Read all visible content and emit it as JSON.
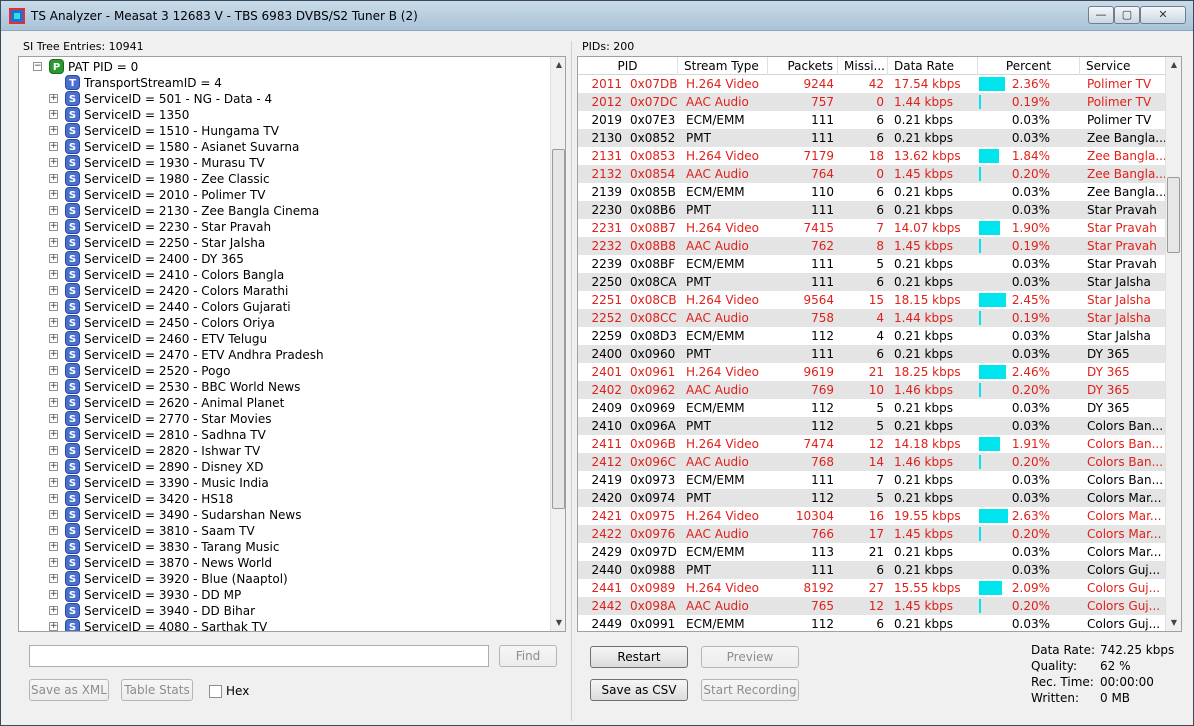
{
  "window": {
    "title": "TS Analyzer - Measat 3 12683 V - TBS 6983 DVBS/S2 Tuner B (2)",
    "min": "—",
    "max": "▢",
    "close": "✕"
  },
  "left": {
    "label": "SI Tree Entries: 10941",
    "tree": [
      {
        "type": "p",
        "text": "PAT PID = 0",
        "expander": "−"
      },
      {
        "type": "t",
        "text": "TransportStreamID = 4"
      },
      {
        "type": "s",
        "text": "ServiceID = 501 - NG - Data - 4"
      },
      {
        "type": "s",
        "text": "ServiceID = 1350"
      },
      {
        "type": "s",
        "text": "ServiceID = 1510 - Hungama TV"
      },
      {
        "type": "s",
        "text": "ServiceID = 1580 - Asianet Suvarna"
      },
      {
        "type": "s",
        "text": "ServiceID = 1930 - Murasu TV"
      },
      {
        "type": "s",
        "text": "ServiceID = 1980 - Zee Classic"
      },
      {
        "type": "s",
        "text": "ServiceID = 2010 - Polimer TV"
      },
      {
        "type": "s",
        "text": "ServiceID = 2130 - Zee Bangla Cinema"
      },
      {
        "type": "s",
        "text": "ServiceID = 2230 - Star Pravah"
      },
      {
        "type": "s",
        "text": "ServiceID = 2250 - Star Jalsha"
      },
      {
        "type": "s",
        "text": "ServiceID = 2400 - DY 365"
      },
      {
        "type": "s",
        "text": "ServiceID = 2410 - Colors Bangla"
      },
      {
        "type": "s",
        "text": "ServiceID = 2420 - Colors Marathi"
      },
      {
        "type": "s",
        "text": "ServiceID = 2440 - Colors Gujarati"
      },
      {
        "type": "s",
        "text": "ServiceID = 2450 - Colors Oriya"
      },
      {
        "type": "s",
        "text": "ServiceID = 2460 - ETV Telugu"
      },
      {
        "type": "s",
        "text": "ServiceID = 2470 - ETV Andhra Pradesh"
      },
      {
        "type": "s",
        "text": "ServiceID = 2520 - Pogo"
      },
      {
        "type": "s",
        "text": "ServiceID = 2530 - BBC World News"
      },
      {
        "type": "s",
        "text": "ServiceID = 2620 - Animal Planet"
      },
      {
        "type": "s",
        "text": "ServiceID = 2770 - Star Movies"
      },
      {
        "type": "s",
        "text": "ServiceID = 2810 - Sadhna TV"
      },
      {
        "type": "s",
        "text": "ServiceID = 2820 - Ishwar TV"
      },
      {
        "type": "s",
        "text": "ServiceID = 2890 - Disney XD"
      },
      {
        "type": "s",
        "text": "ServiceID = 3390 - Music India"
      },
      {
        "type": "s",
        "text": "ServiceID = 3420 - HS18"
      },
      {
        "type": "s",
        "text": "ServiceID = 3490 - Sudarshan News"
      },
      {
        "type": "s",
        "text": "ServiceID = 3810 - Saam TV"
      },
      {
        "type": "s",
        "text": "ServiceID = 3830 - Tarang Music"
      },
      {
        "type": "s",
        "text": "ServiceID = 3870 - News World"
      },
      {
        "type": "s",
        "text": "ServiceID = 3920 - Blue (Naaptol)"
      },
      {
        "type": "s",
        "text": "ServiceID = 3930 - DD MP"
      },
      {
        "type": "s",
        "text": "ServiceID = 3940 - DD Bihar"
      },
      {
        "type": "s",
        "text": "ServiceID = 4080 - Sarthak TV"
      }
    ],
    "search_placeholder": "",
    "find": "Find",
    "save_xml": "Save as XML",
    "table_stats": "Table Stats",
    "hex": "Hex"
  },
  "right": {
    "label": "PIDs: 200",
    "columns": [
      "PID",
      "Stream Type",
      "Packets",
      "Missi...",
      "Data Rate",
      "Percent",
      "Service"
    ],
    "rows": [
      {
        "pid": "2011",
        "hex": "0x07DB",
        "type": "H.264 Video",
        "packets": "9244",
        "miss": "42",
        "rate": "17.54 kbps",
        "pct": "2.36%",
        "pctv": 2.36,
        "service": "Polimer TV",
        "red": true
      },
      {
        "pid": "2012",
        "hex": "0x07DC",
        "type": "AAC Audio",
        "packets": "757",
        "miss": "0",
        "rate": "1.44 kbps",
        "pct": "0.19%",
        "pctv": 0.19,
        "service": "Polimer TV",
        "red": true
      },
      {
        "pid": "2019",
        "hex": "0x07E3",
        "type": "ECM/EMM",
        "packets": "111",
        "miss": "6",
        "rate": "0.21 kbps",
        "pct": "0.03%",
        "pctv": 0,
        "service": "Polimer TV",
        "red": false
      },
      {
        "pid": "2130",
        "hex": "0x0852",
        "type": "PMT",
        "packets": "111",
        "miss": "6",
        "rate": "0.21 kbps",
        "pct": "0.03%",
        "pctv": 0,
        "service": "Zee Bangla...",
        "red": false
      },
      {
        "pid": "2131",
        "hex": "0x0853",
        "type": "H.264 Video",
        "packets": "7179",
        "miss": "18",
        "rate": "13.62 kbps",
        "pct": "1.84%",
        "pctv": 1.84,
        "service": "Zee Bangla...",
        "red": true
      },
      {
        "pid": "2132",
        "hex": "0x0854",
        "type": "AAC Audio",
        "packets": "764",
        "miss": "0",
        "rate": "1.45 kbps",
        "pct": "0.20%",
        "pctv": 0.2,
        "service": "Zee Bangla...",
        "red": true
      },
      {
        "pid": "2139",
        "hex": "0x085B",
        "type": "ECM/EMM",
        "packets": "110",
        "miss": "6",
        "rate": "0.21 kbps",
        "pct": "0.03%",
        "pctv": 0,
        "service": "Zee Bangla...",
        "red": false
      },
      {
        "pid": "2230",
        "hex": "0x08B6",
        "type": "PMT",
        "packets": "111",
        "miss": "6",
        "rate": "0.21 kbps",
        "pct": "0.03%",
        "pctv": 0,
        "service": "Star Pravah",
        "red": false
      },
      {
        "pid": "2231",
        "hex": "0x08B7",
        "type": "H.264 Video",
        "packets": "7415",
        "miss": "7",
        "rate": "14.07 kbps",
        "pct": "1.90%",
        "pctv": 1.9,
        "service": "Star Pravah",
        "red": true
      },
      {
        "pid": "2232",
        "hex": "0x08B8",
        "type": "AAC Audio",
        "packets": "762",
        "miss": "8",
        "rate": "1.45 kbps",
        "pct": "0.19%",
        "pctv": 0.19,
        "service": "Star Pravah",
        "red": true
      },
      {
        "pid": "2239",
        "hex": "0x08BF",
        "type": "ECM/EMM",
        "packets": "111",
        "miss": "5",
        "rate": "0.21 kbps",
        "pct": "0.03%",
        "pctv": 0,
        "service": "Star Pravah",
        "red": false
      },
      {
        "pid": "2250",
        "hex": "0x08CA",
        "type": "PMT",
        "packets": "111",
        "miss": "6",
        "rate": "0.21 kbps",
        "pct": "0.03%",
        "pctv": 0,
        "service": "Star Jalsha",
        "red": false
      },
      {
        "pid": "2251",
        "hex": "0x08CB",
        "type": "H.264 Video",
        "packets": "9564",
        "miss": "15",
        "rate": "18.15 kbps",
        "pct": "2.45%",
        "pctv": 2.45,
        "service": "Star Jalsha",
        "red": true
      },
      {
        "pid": "2252",
        "hex": "0x08CC",
        "type": "AAC Audio",
        "packets": "758",
        "miss": "4",
        "rate": "1.44 kbps",
        "pct": "0.19%",
        "pctv": 0.19,
        "service": "Star Jalsha",
        "red": true
      },
      {
        "pid": "2259",
        "hex": "0x08D3",
        "type": "ECM/EMM",
        "packets": "112",
        "miss": "4",
        "rate": "0.21 kbps",
        "pct": "0.03%",
        "pctv": 0,
        "service": "Star Jalsha",
        "red": false
      },
      {
        "pid": "2400",
        "hex": "0x0960",
        "type": "PMT",
        "packets": "111",
        "miss": "6",
        "rate": "0.21 kbps",
        "pct": "0.03%",
        "pctv": 0,
        "service": "DY 365",
        "red": false
      },
      {
        "pid": "2401",
        "hex": "0x0961",
        "type": "H.264 Video",
        "packets": "9619",
        "miss": "21",
        "rate": "18.25 kbps",
        "pct": "2.46%",
        "pctv": 2.46,
        "service": "DY 365",
        "red": true
      },
      {
        "pid": "2402",
        "hex": "0x0962",
        "type": "AAC Audio",
        "packets": "769",
        "miss": "10",
        "rate": "1.46 kbps",
        "pct": "0.20%",
        "pctv": 0.2,
        "service": "DY 365",
        "red": true
      },
      {
        "pid": "2409",
        "hex": "0x0969",
        "type": "ECM/EMM",
        "packets": "112",
        "miss": "5",
        "rate": "0.21 kbps",
        "pct": "0.03%",
        "pctv": 0,
        "service": "DY 365",
        "red": false
      },
      {
        "pid": "2410",
        "hex": "0x096A",
        "type": "PMT",
        "packets": "112",
        "miss": "5",
        "rate": "0.21 kbps",
        "pct": "0.03%",
        "pctv": 0,
        "service": "Colors Ban...",
        "red": false
      },
      {
        "pid": "2411",
        "hex": "0x096B",
        "type": "H.264 Video",
        "packets": "7474",
        "miss": "12",
        "rate": "14.18 kbps",
        "pct": "1.91%",
        "pctv": 1.91,
        "service": "Colors Ban...",
        "red": true
      },
      {
        "pid": "2412",
        "hex": "0x096C",
        "type": "AAC Audio",
        "packets": "768",
        "miss": "14",
        "rate": "1.46 kbps",
        "pct": "0.20%",
        "pctv": 0.2,
        "service": "Colors Ban...",
        "red": true
      },
      {
        "pid": "2419",
        "hex": "0x0973",
        "type": "ECM/EMM",
        "packets": "111",
        "miss": "7",
        "rate": "0.21 kbps",
        "pct": "0.03%",
        "pctv": 0,
        "service": "Colors Ban...",
        "red": false
      },
      {
        "pid": "2420",
        "hex": "0x0974",
        "type": "PMT",
        "packets": "112",
        "miss": "5",
        "rate": "0.21 kbps",
        "pct": "0.03%",
        "pctv": 0,
        "service": "Colors Mar...",
        "red": false
      },
      {
        "pid": "2421",
        "hex": "0x0975",
        "type": "H.264 Video",
        "packets": "10304",
        "miss": "16",
        "rate": "19.55 kbps",
        "pct": "2.63%",
        "pctv": 2.63,
        "service": "Colors Mar...",
        "red": true
      },
      {
        "pid": "2422",
        "hex": "0x0976",
        "type": "AAC Audio",
        "packets": "766",
        "miss": "17",
        "rate": "1.45 kbps",
        "pct": "0.20%",
        "pctv": 0.2,
        "service": "Colors Mar...",
        "red": true
      },
      {
        "pid": "2429",
        "hex": "0x097D",
        "type": "ECM/EMM",
        "packets": "113",
        "miss": "21",
        "rate": "0.21 kbps",
        "pct": "0.03%",
        "pctv": 0,
        "service": "Colors Mar...",
        "red": false
      },
      {
        "pid": "2440",
        "hex": "0x0988",
        "type": "PMT",
        "packets": "111",
        "miss": "6",
        "rate": "0.21 kbps",
        "pct": "0.03%",
        "pctv": 0,
        "service": "Colors Guj...",
        "red": false
      },
      {
        "pid": "2441",
        "hex": "0x0989",
        "type": "H.264 Video",
        "packets": "8192",
        "miss": "27",
        "rate": "15.55 kbps",
        "pct": "2.09%",
        "pctv": 2.09,
        "service": "Colors Guj...",
        "red": true
      },
      {
        "pid": "2442",
        "hex": "0x098A",
        "type": "AAC Audio",
        "packets": "765",
        "miss": "12",
        "rate": "1.45 kbps",
        "pct": "0.20%",
        "pctv": 0.2,
        "service": "Colors Guj...",
        "red": true
      },
      {
        "pid": "2449",
        "hex": "0x0991",
        "type": "ECM/EMM",
        "packets": "112",
        "miss": "6",
        "rate": "0.21 kbps",
        "pct": "0.03%",
        "pctv": 0,
        "service": "Colors Guj...",
        "red": false
      }
    ],
    "restart": "Restart",
    "preview": "Preview",
    "save_csv": "Save as CSV",
    "start_recording": "Start Recording"
  },
  "stats": {
    "data_rate_label": "Data Rate:",
    "data_rate": "742.25 kbps",
    "quality_label": "Quality:",
    "quality": "62 %",
    "rec_time_label": "Rec. Time:",
    "rec_time": "00:00:00",
    "written_label": "Written:",
    "written": "0 MB"
  },
  "colors": {
    "red_text": "#e0201a",
    "bar": "#00e5ee"
  }
}
